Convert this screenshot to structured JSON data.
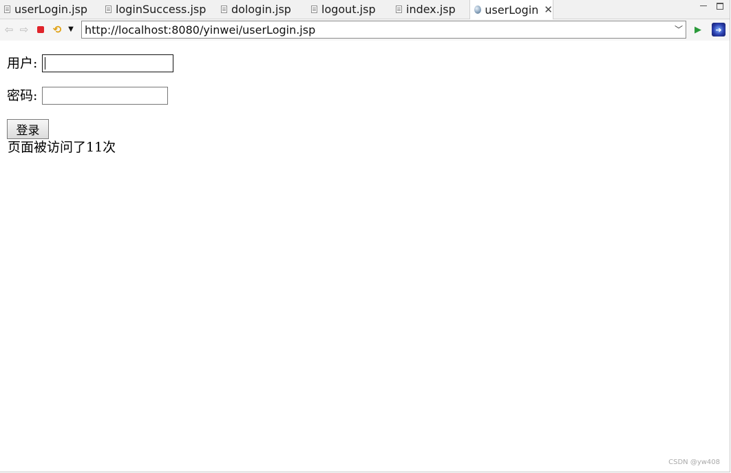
{
  "tabs": [
    {
      "label": "userLogin.jsp",
      "icon": "jsp-file-icon"
    },
    {
      "label": "loginSuccess.jsp",
      "icon": "jsp-file-icon"
    },
    {
      "label": "dologin.jsp",
      "icon": "jsp-file-icon"
    },
    {
      "label": "logout.jsp",
      "icon": "jsp-file-icon"
    },
    {
      "label": "index.jsp",
      "icon": "jsp-file-icon"
    },
    {
      "label": "userLogin",
      "icon": "globe-icon",
      "active": true
    }
  ],
  "tab_close_glyph": "✕",
  "toolbar": {
    "url": "http://localhost:8080/yinwei/userLogin.jsp",
    "stop_color": "#e0242b",
    "go_color": "#2a9a3a"
  },
  "page": {
    "username_label": "用户:",
    "username_value": "",
    "password_label": "密码:",
    "password_value": "",
    "submit_label": "登录",
    "visit_text": "页面被访问了11次"
  },
  "watermark": "CSDN @yw408"
}
